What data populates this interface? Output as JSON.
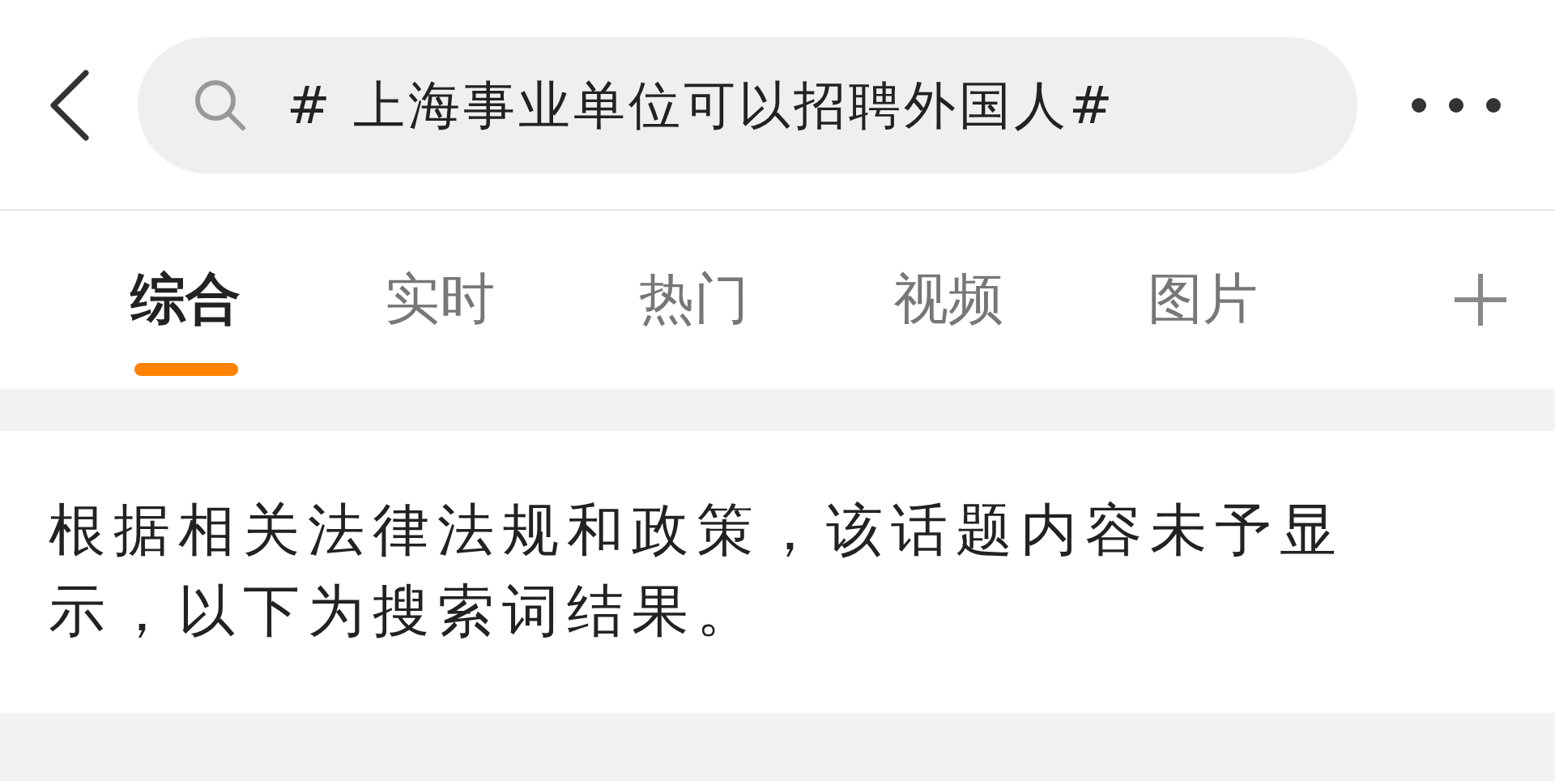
{
  "search": {
    "value": "# 上海事业单位可以招聘外国人#"
  },
  "tabs": [
    {
      "label": "综合",
      "selected": true
    },
    {
      "label": "实时",
      "selected": false
    },
    {
      "label": "热门",
      "selected": false
    },
    {
      "label": "视频",
      "selected": false
    },
    {
      "label": "图片",
      "selected": false
    }
  ],
  "notice": "根据相关法律法规和政策，该话题内容未予显示，以下为搜索词结果。"
}
